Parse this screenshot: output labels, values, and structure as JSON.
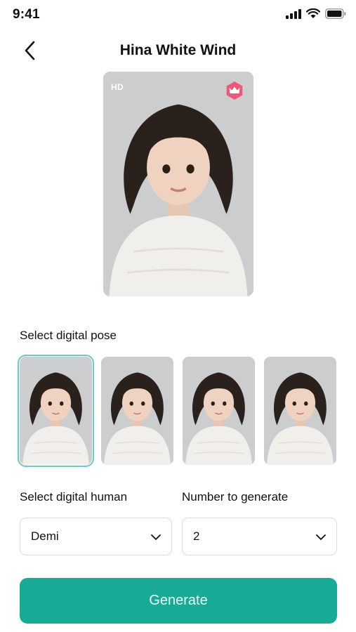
{
  "status_bar": {
    "time": "9:41"
  },
  "nav": {
    "title": "Hina White Wind"
  },
  "preview": {
    "quality_badge": "HD",
    "premium_icon": "crown-icon"
  },
  "pose_section": {
    "label": "Select digital pose",
    "poses": [
      {
        "selected": true
      },
      {
        "selected": false
      },
      {
        "selected": false
      },
      {
        "selected": false
      }
    ]
  },
  "digital_human": {
    "label": "Select digital human",
    "value": "Demi"
  },
  "count": {
    "label": "Number to generate",
    "value": "2"
  },
  "generate": {
    "label": "Generate"
  },
  "colors": {
    "accent": "#17aa95",
    "selected_outline": "#6cc9c8",
    "premium": "#f0567a"
  }
}
